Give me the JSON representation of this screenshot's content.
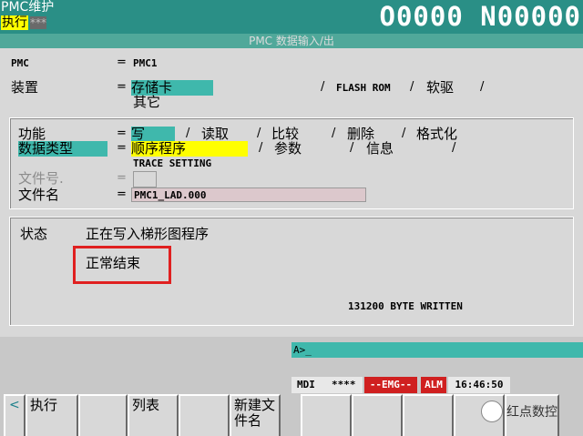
{
  "header": {
    "title": "PMC维护",
    "mode": "执行",
    "stars": "***",
    "program": "O0000 N00000"
  },
  "subtitle": "PMC 数据输入/出",
  "form": {
    "pmc_label": "PMC",
    "pmc_eq": "=",
    "pmc_value": "PMC1",
    "device_label": "装置",
    "device_eq": "=",
    "device_options": [
      "存储卡",
      "FLASH ROM",
      "软驱",
      "其它"
    ],
    "device_sep": "/",
    "function_label": "功能",
    "function_eq": "=",
    "function_options": [
      "写",
      "读取",
      "比较",
      "删除",
      "格式化"
    ],
    "datatype_label": "数据类型",
    "datatype_eq": "=",
    "datatype_options": [
      "顺序程序",
      "参数",
      "信息"
    ],
    "trace_setting": "TRACE SETTING",
    "fileno_label": "文件号.",
    "fileno_eq": "=",
    "filename_label": "文件名",
    "filename_eq": "=",
    "filename_value": "PMC1_LAD.000"
  },
  "status": {
    "label": "状态",
    "message": "正在写入梯形图程序",
    "result": "正常结束",
    "bytes": "131200 BYTE WRITTEN"
  },
  "input_line": "A>_",
  "statusbar": {
    "mode": "MDI",
    "stars": "****",
    "emg": "--EMG--",
    "alm": "ALM",
    "time": "16:46:50"
  },
  "softkeys": {
    "left_arrow": "<",
    "k1": "执行",
    "k2": "",
    "k3": "列表",
    "k4": "",
    "k5": "新建文件名",
    "k6": "",
    "k7": "",
    "k8": "",
    "k9": "",
    "k10": ""
  },
  "watermark": "红点数控",
  "colors": {
    "header_bg": "#2a8f86",
    "selection_teal": "#3fb8ac",
    "selection_yellow": "#ffff00",
    "alarm_red": "#e02020"
  }
}
